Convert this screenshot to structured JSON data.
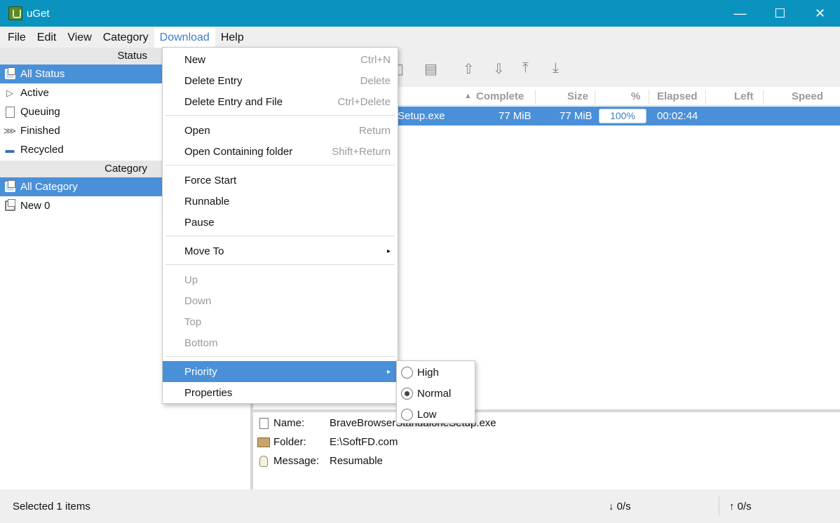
{
  "window": {
    "title": "uGet",
    "minimize": "—",
    "maximize": "☐",
    "close": "✕"
  },
  "menubar": {
    "file": "File",
    "edit": "Edit",
    "view": "View",
    "category": "Category",
    "download": "Download",
    "help": "Help"
  },
  "sidebar": {
    "status_header": "Status",
    "status_items": [
      {
        "label": "All Status",
        "icon": "stack-icon",
        "selected": true
      },
      {
        "label": "Active",
        "icon": "play-icon",
        "selected": false
      },
      {
        "label": "Queuing",
        "icon": "page-icon",
        "selected": false
      },
      {
        "label": "Finished",
        "icon": "finish-icon",
        "selected": false
      },
      {
        "label": "Recycled",
        "icon": "minus-icon",
        "selected": false
      }
    ],
    "category_header": "Category",
    "category_items": [
      {
        "label": "All Category",
        "icon": "stack-icon",
        "selected": true
      },
      {
        "label": "New 0",
        "icon": "stack-icon",
        "selected": false
      }
    ]
  },
  "list": {
    "columns": {
      "complete": "Complete",
      "size": "Size",
      "percent": "%",
      "elapsed": "Elapsed",
      "left": "Left",
      "speed": "Speed"
    },
    "sort_indicator": "▲",
    "rows": [
      {
        "name": "Setup.exe",
        "complete": "77 MiB",
        "size": "77 MiB",
        "percent": "100%",
        "elapsed": "00:02:44"
      }
    ]
  },
  "details": {
    "name_label": "Name:",
    "name_value": "BraveBrowserStandaloneSetup.exe",
    "folder_label": "Folder:",
    "folder_value": "E:\\SoftFD.com",
    "message_label": "Message:",
    "message_value": "Resumable"
  },
  "statusbar": {
    "selected": "Selected 1 items",
    "down_speed": "↓ 0/s",
    "up_speed": "↑ 0/s"
  },
  "download_menu": {
    "new": "New",
    "new_accel": "Ctrl+N",
    "delete_entry": "Delete Entry",
    "delete_entry_accel": "Delete",
    "delete_entry_file": "Delete Entry and File",
    "delete_entry_file_accel": "Ctrl+Delete",
    "open": "Open",
    "open_accel": "Return",
    "open_folder": "Open Containing folder",
    "open_folder_accel": "Shift+Return",
    "force_start": "Force Start",
    "runnable": "Runnable",
    "pause": "Pause",
    "move_to": "Move To",
    "up": "Up",
    "down": "Down",
    "top": "Top",
    "bottom": "Bottom",
    "priority": "Priority",
    "properties": "Properties",
    "submenu_arrow": "▸"
  },
  "priority_menu": {
    "high": "High",
    "normal": "Normal",
    "low": "Low",
    "selected": "Normal"
  },
  "colors": {
    "titlebar": "#0b93c0",
    "selection": "#4a90d9",
    "menu_active": "#3d7ec8"
  }
}
